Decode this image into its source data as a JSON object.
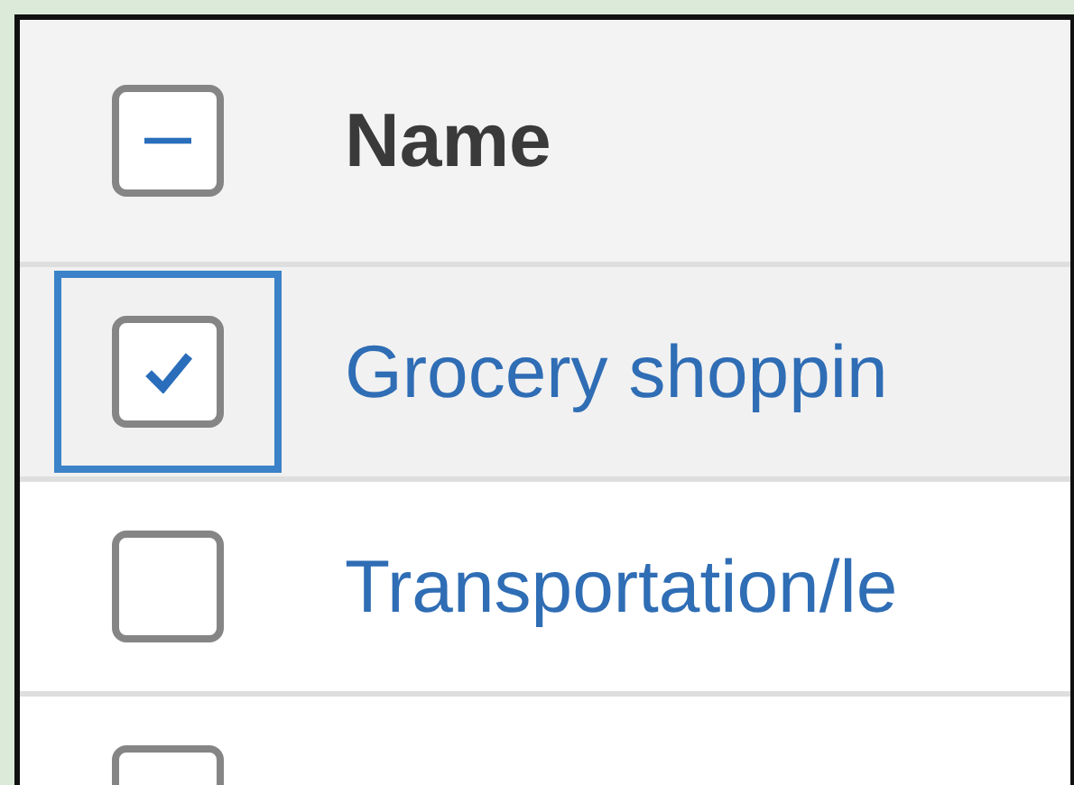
{
  "table": {
    "header": {
      "label": "Name",
      "indeterminate": true
    },
    "rows": [
      {
        "label": "Grocery shoppin",
        "checked": true,
        "focused": true
      },
      {
        "label": "Transportation/le",
        "checked": false,
        "focused": false
      },
      {
        "checked": false,
        "focused": false
      }
    ]
  }
}
